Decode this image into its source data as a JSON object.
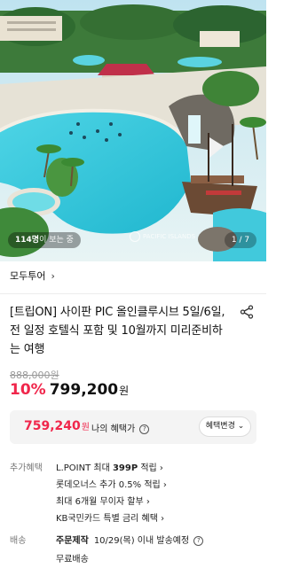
{
  "hero": {
    "viewers_count": "114명",
    "viewers_suffix": "이 보는 중",
    "watermark": "PACIFIC ISLANDS",
    "counter": "1 / 7"
  },
  "seller": {
    "name": "모두투어",
    "chevron": "›"
  },
  "product": {
    "title": "[트립ON] 사이판 PIC 올인클루시브 5일/6일, 전 일정 호텔식 포함 및 10월까지 미리준비하는 여행",
    "original_price": "888,000원",
    "discount": "10%",
    "price": "799,200",
    "price_unit": "원"
  },
  "benefit": {
    "price": "759,240",
    "price_unit": "원",
    "label": "나의 혜택가",
    "help": "?",
    "change_button": "혜택변경 ⌄"
  },
  "extra_benefits": {
    "label": "추가혜택",
    "items": [
      {
        "prefix": "L.POINT 최대 ",
        "bold": "399P",
        "suffix": " 적립 ›"
      },
      {
        "prefix": "롯데오너스 추가 0.5% 적립 ›",
        "bold": "",
        "suffix": ""
      },
      {
        "prefix": "최대 6개월 무이자 할부 ›",
        "bold": "",
        "suffix": ""
      },
      {
        "prefix": "KB국민카드 특별 금리 혜택 ›",
        "bold": "",
        "suffix": ""
      }
    ]
  },
  "delivery": {
    "label": "배송",
    "type": "주문제작",
    "date": "10/29(목) 이내 발송예정",
    "help": "?",
    "fee": "무료배송"
  }
}
